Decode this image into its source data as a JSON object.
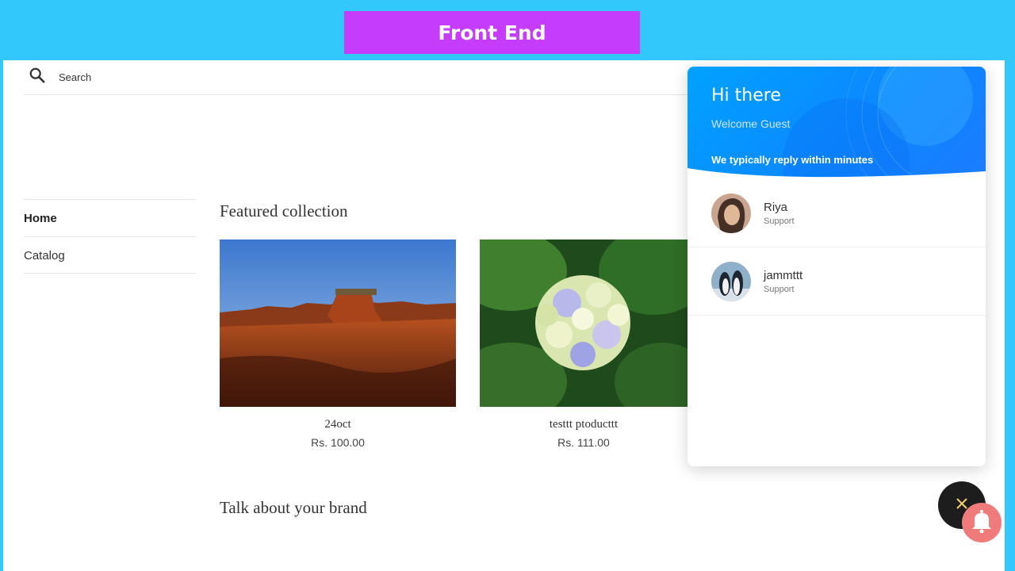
{
  "banner": {
    "label": "Front End"
  },
  "search": {
    "label": "Search"
  },
  "nav": {
    "items": [
      {
        "label": "Home"
      },
      {
        "label": "Catalog"
      }
    ]
  },
  "featured": {
    "title": "Featured collection",
    "products": [
      {
        "name": "24oct",
        "price": "Rs. 100.00",
        "image": "desert-butte-photo"
      },
      {
        "name": "testtt ptoducttt",
        "price": "Rs. 111.00",
        "image": "hydrangea-flower-photo"
      }
    ]
  },
  "brand": {
    "title": "Talk about your brand"
  },
  "chat": {
    "greeting": "Hi there",
    "welcome": "Welcome Guest",
    "reply_time": "We typically reply within minutes",
    "agents": [
      {
        "name": "Riya",
        "role": "Support",
        "avatar": "woman-portrait"
      },
      {
        "name": "jammttt",
        "role": "Support",
        "avatar": "penguins"
      }
    ]
  },
  "icons": {
    "search": "search-icon",
    "close": "close-icon",
    "bell": "bell-icon"
  },
  "colors": {
    "background": "#33c8fc",
    "banner": "#c63cfc",
    "chat_header": "#0d86ff",
    "close_button": "#1d1d1d",
    "close_icon": "#f4d46a",
    "bell_button": "#ef7b7b"
  }
}
